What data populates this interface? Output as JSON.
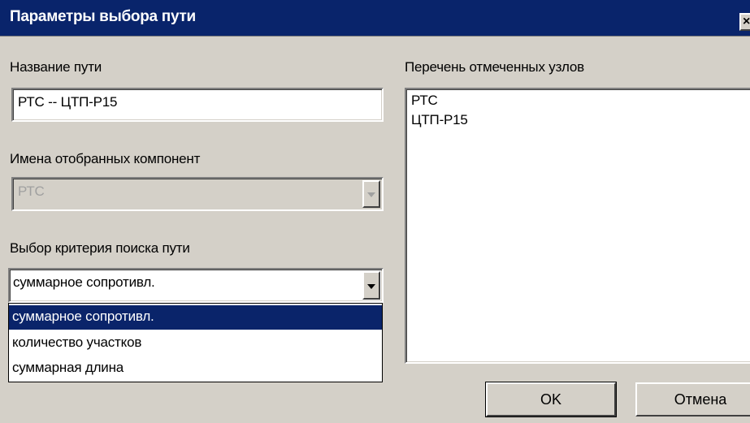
{
  "window": {
    "title": "Параметры выбора пути"
  },
  "path_name": {
    "label": "Название пути",
    "value": "РТС -- ЦТП-Р15"
  },
  "components": {
    "label": "Имена отобранных компонент",
    "value": "РТС"
  },
  "criteria": {
    "label": "Выбор критерия поиска пути",
    "value": "суммарное сопротивл.",
    "options": [
      {
        "label": "суммарное сопротивл.",
        "selected": true
      },
      {
        "label": "количество участков",
        "selected": false
      },
      {
        "label": "суммарная длина",
        "selected": false
      }
    ]
  },
  "nodes": {
    "label": "Перечень отмеченных узлов",
    "items": [
      "РТС",
      "ЦТП-Р15"
    ]
  },
  "buttons": {
    "ok_label": "OK",
    "cancel_label": "Отмена"
  },
  "colors": {
    "titlebar": "#09246b",
    "selection": "#0a246a",
    "face": "#d4d0c8"
  }
}
